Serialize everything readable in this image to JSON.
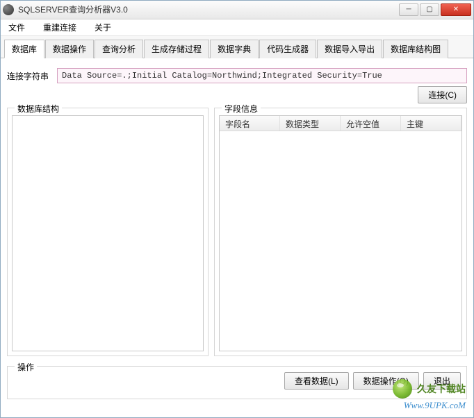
{
  "window": {
    "title": "SQLSERVER查询分析器V3.0"
  },
  "menu": {
    "file": "文件",
    "reconnect": "重建连接",
    "about": "关于"
  },
  "tabs": [
    {
      "label": "数据库",
      "active": true
    },
    {
      "label": "数据操作"
    },
    {
      "label": "查询分析"
    },
    {
      "label": "生成存储过程"
    },
    {
      "label": "数据字典"
    },
    {
      "label": "代码生成器"
    },
    {
      "label": "数据导入导出"
    },
    {
      "label": "数据库结构图"
    }
  ],
  "connection": {
    "label": "连接字符串",
    "value": "Data Source=.;Initial Catalog=Northwind;Integrated Security=True",
    "button": "连接(C)"
  },
  "panels": {
    "dbstruct": {
      "title": "数据库结构"
    },
    "fieldinfo": {
      "title": "字段信息",
      "columns": [
        "字段名",
        "数据类型",
        "允许空值",
        "主键"
      ]
    }
  },
  "ops": {
    "title": "操作",
    "buttons": {
      "viewdata": "查看数据(L)",
      "dataop": "数据操作(O)",
      "exit": "退出"
    }
  },
  "watermark": {
    "brand": "久友下载站",
    "url": "Www.9UPK.coM"
  }
}
